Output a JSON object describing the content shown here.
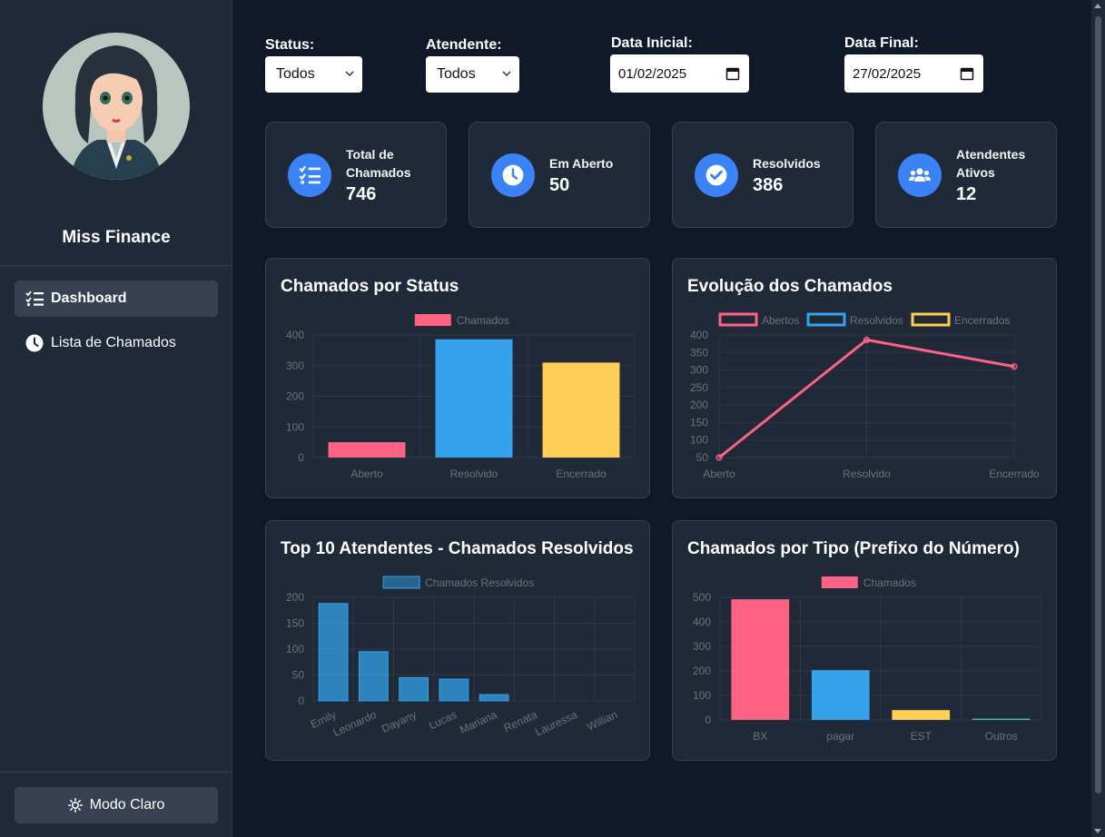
{
  "sidebar": {
    "profile_name": "Miss Finance",
    "nav": [
      {
        "label": "Dashboard",
        "icon": "list-check-icon",
        "active": true
      },
      {
        "label": "Lista de Chamados",
        "icon": "clock-icon",
        "active": false
      }
    ],
    "mode_button": {
      "label": "Modo Claro",
      "icon": "sun-icon"
    }
  },
  "filters": {
    "status": {
      "label": "Status:",
      "value": "Todos"
    },
    "atendente": {
      "label": "Atendente:",
      "value": "Todos"
    },
    "data_inicial": {
      "label": "Data Inicial:",
      "value": "01/02/2025"
    },
    "data_final": {
      "label": "Data Final:",
      "value": "27/02/2025"
    }
  },
  "stats": [
    {
      "label_lines": [
        "Total de",
        "Chamados"
      ],
      "value": "746",
      "icon": "list-check-icon"
    },
    {
      "label_lines": [
        "Em Aberto"
      ],
      "value": "50",
      "icon": "clock-icon"
    },
    {
      "label_lines": [
        "Resolvidos"
      ],
      "value": "386",
      "icon": "check-circle-icon"
    },
    {
      "label_lines": [
        "Atendentes",
        "Ativos"
      ],
      "value": "12",
      "icon": "users-icon"
    }
  ],
  "colors": {
    "pink": "#ff6384",
    "blue": "#36a2eb",
    "yellow": "#ffce56",
    "teal": "#4bc0c0",
    "blue_dark": "#2f78b0",
    "accent": "#3b82f6"
  },
  "chart_data": [
    {
      "id": "status",
      "title": "Chamados por Status",
      "type": "bar",
      "legend": [
        "Chamados"
      ],
      "categories": [
        "Aberto",
        "Resolvido",
        "Encerrado"
      ],
      "values": [
        50,
        386,
        310
      ],
      "ylim": [
        0,
        400
      ],
      "yticks": [
        0,
        100,
        200,
        300,
        400
      ],
      "grid": true
    },
    {
      "id": "evolucao",
      "title": "Evolução dos Chamados",
      "type": "line",
      "legend": [
        "Abertos",
        "Resolvidos",
        "Encerrados"
      ],
      "categories": [
        "Aberto",
        "Resolvido",
        "Encerrado"
      ],
      "values": [
        50,
        386,
        310
      ],
      "ylim": [
        50,
        400
      ],
      "yticks": [
        50,
        100,
        150,
        200,
        250,
        300,
        350,
        400
      ],
      "grid": true
    },
    {
      "id": "top10",
      "title": "Top 10 Atendentes - Chamados Resolvidos",
      "type": "bar",
      "legend": [
        "Chamados Resolvidos"
      ],
      "categories": [
        "Emily",
        "Leonardo",
        "Dayany",
        "Lucas",
        "Mariana",
        "Renata",
        "Lauressa",
        "Willian"
      ],
      "values": [
        188,
        95,
        45,
        42,
        12,
        0,
        0,
        0
      ],
      "ylim": [
        0,
        200
      ],
      "yticks": [
        0,
        50,
        100,
        150,
        200
      ],
      "grid": true
    },
    {
      "id": "tipo",
      "title": "Chamados por Tipo (Prefixo do Número)",
      "type": "bar",
      "legend": [
        "Chamados"
      ],
      "categories": [
        "BX",
        "pagar",
        "EST",
        "Outros"
      ],
      "values": [
        492,
        203,
        40,
        5
      ],
      "ylim": [
        0,
        500
      ],
      "yticks": [
        0,
        100,
        200,
        300,
        400,
        500
      ],
      "grid": true
    }
  ]
}
